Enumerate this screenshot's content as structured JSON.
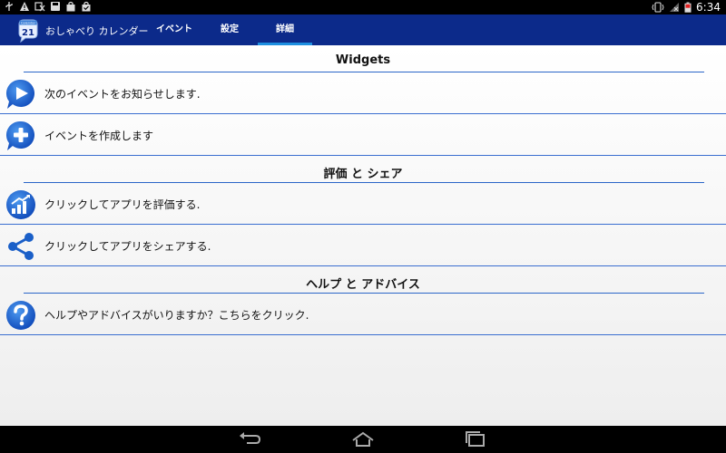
{
  "status_bar": {
    "time": "6:34",
    "left_icons": [
      "usb-icon",
      "warning-icon",
      "alarm-off-icon",
      "save-icon",
      "shopping-bag-icon",
      "shopping-bag-check-icon"
    ],
    "right_icons": [
      "vibrate-icon",
      "no-signal-icon",
      "battery-icon"
    ]
  },
  "action_bar": {
    "logo": {
      "badge_text": "21",
      "top_text": "Calendar"
    },
    "app_title": "おしゃべり カレンダー",
    "tabs": [
      {
        "label": "イベント",
        "active": false
      },
      {
        "label": "設定",
        "active": false
      },
      {
        "label": "詳細",
        "active": true
      }
    ]
  },
  "sections": [
    {
      "title": "Widgets",
      "rows": [
        {
          "label": "次のイベントをお知らせします.",
          "icon": "play-icon"
        },
        {
          "label": "イベントを作成します",
          "icon": "add-icon"
        }
      ]
    },
    {
      "title": "評価 と シェア",
      "rows": [
        {
          "label": "クリックしてアプリを評価する.",
          "icon": "rate-chart-icon"
        },
        {
          "label": "クリックしてアプリをシェアする.",
          "icon": "share-icon"
        }
      ]
    },
    {
      "title": "ヘルプ と アドバイス",
      "rows": [
        {
          "label": "ヘルプやアドバイスがいりますか？こちらをクリック.",
          "icon": "help-icon"
        }
      ]
    }
  ],
  "colors": {
    "action_bar": "#0c2a8a",
    "tab_indicator": "#1e8fe0",
    "divider": "#2b66c8",
    "icon_blue": "#1a5fc8"
  },
  "nav_bar": {
    "buttons": [
      "back-icon",
      "home-icon",
      "recent-apps-icon"
    ]
  }
}
